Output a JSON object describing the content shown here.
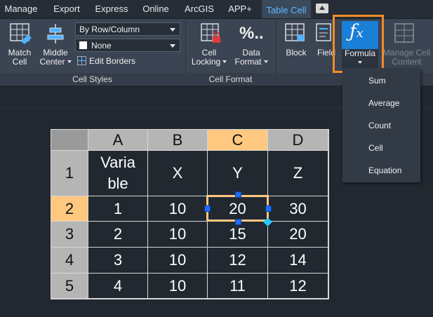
{
  "tabs": [
    {
      "label": "Manage",
      "active": false
    },
    {
      "label": "Export",
      "active": false
    },
    {
      "label": "Express",
      "active": false
    },
    {
      "label": "Online",
      "active": false
    },
    {
      "label": "ArcGIS",
      "active": false
    },
    {
      "label": "APP+",
      "active": false
    },
    {
      "label": "Table Cell",
      "active": true
    }
  ],
  "ribbon": {
    "match_cell": {
      "line1": "Match",
      "line2": "Cell"
    },
    "middle_center": {
      "line1": "Middle",
      "line2": "Center"
    },
    "row_column_select": "By Row/Column",
    "border_color_select": "None",
    "edit_borders": "Edit Borders",
    "cell_locking": {
      "line1": "Cell",
      "line2": "Locking"
    },
    "data_format": {
      "line1": "Data",
      "line2": "Format"
    },
    "block": "Block",
    "field": "Field",
    "formula": "Formula",
    "manage_cell_content": {
      "line1": "Manage Cell",
      "line2": "Content"
    },
    "panels": {
      "cell_styles": "Cell Styles",
      "cell_format": "Cell Format"
    }
  },
  "formula_menu": [
    "Sum",
    "Average",
    "Count",
    "Cell",
    "Equation"
  ],
  "table": {
    "columns": [
      "A",
      "B",
      "C",
      "D"
    ],
    "rows": [
      {
        "num": "1",
        "cells": [
          "Varia ble",
          "X",
          "Y",
          "Z"
        ]
      },
      {
        "num": "2",
        "cells": [
          "1",
          "10",
          "20",
          "30"
        ]
      },
      {
        "num": "3",
        "cells": [
          "2",
          "10",
          "15",
          "20"
        ]
      },
      {
        "num": "4",
        "cells": [
          "3",
          "10",
          "12",
          "14"
        ]
      },
      {
        "num": "5",
        "cells": [
          "4",
          "10",
          "11",
          "12"
        ]
      }
    ],
    "selected_cell": "C2"
  },
  "colors": {
    "accent": "#5fb7ff",
    "highlight": "#f28c28",
    "selection": "#ffc880"
  }
}
